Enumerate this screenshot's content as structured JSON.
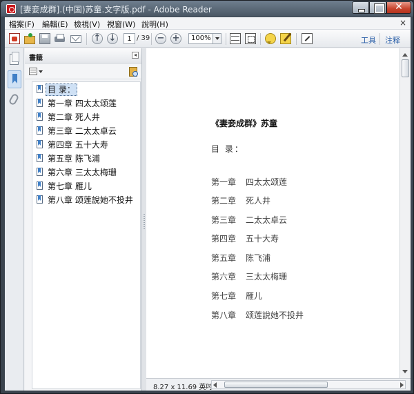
{
  "window": {
    "title": "[妻妾成群].(中国)苏童.文字版.pdf - Adobe Reader"
  },
  "menu": {
    "items": [
      "檔案(F)",
      "編輯(E)",
      "檢視(V)",
      "視窗(W)",
      "說明(H)"
    ],
    "close": "×"
  },
  "toolbar": {
    "page_current": "1",
    "page_total": "/ 39",
    "zoom": "100%",
    "tools_label": "工具",
    "comment_label": "注释"
  },
  "bookmarks_panel": {
    "title": "書籤",
    "items": [
      "目 录：",
      "第一章  四太太颂莲",
      "第二章  死人井",
      "第三章  二太太卓云",
      "第四章  五十大寿",
      "第五章  陈飞浦",
      "第六章  三太太梅珊",
      "第七章  雁儿",
      "第八章  颂莲說她不投井"
    ],
    "selected_index": 0
  },
  "document": {
    "title": "《妻妾成群》苏童",
    "toc_heading": "目   录：",
    "chapters": [
      {
        "chapter": "第一章",
        "name": "四太太颂莲"
      },
      {
        "chapter": "第二章",
        "name": "死人井"
      },
      {
        "chapter": "第三章",
        "name": "二太太卓云"
      },
      {
        "chapter": "第四章",
        "name": "五十大寿"
      },
      {
        "chapter": "第五章",
        "name": "陈飞浦"
      },
      {
        "chapter": "第六章",
        "name": "三太太梅珊"
      },
      {
        "chapter": "第七章",
        "name": "雁儿"
      },
      {
        "chapter": "第八章",
        "name": "颂莲說她不投井"
      }
    ]
  },
  "status": {
    "page_size": "8.27 x 11.69 英吋"
  },
  "colors": {
    "accent_link": "#2a5fa8",
    "selection": "#cfe1f5",
    "close_button": "#c8442d"
  }
}
